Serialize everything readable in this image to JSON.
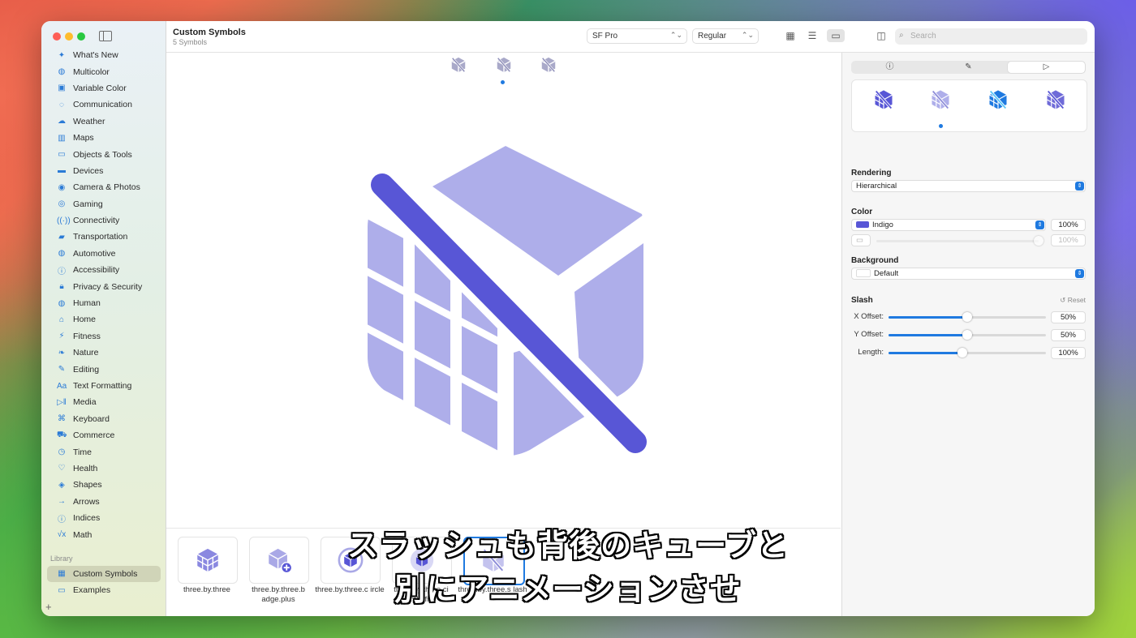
{
  "window": {
    "title": "Custom Symbols",
    "subtitle": "5 Symbols"
  },
  "sidebar": {
    "items": [
      {
        "label": "What's New",
        "icon": "sparkle-icon"
      },
      {
        "label": "Multicolor",
        "icon": "paintpalette-icon"
      },
      {
        "label": "Variable Color",
        "icon": "variable-color-icon"
      },
      {
        "label": "Communication",
        "icon": "message-icon"
      },
      {
        "label": "Weather",
        "icon": "cloud-sun-icon"
      },
      {
        "label": "Maps",
        "icon": "map-icon"
      },
      {
        "label": "Objects & Tools",
        "icon": "folder-icon"
      },
      {
        "label": "Devices",
        "icon": "display-icon"
      },
      {
        "label": "Camera & Photos",
        "icon": "camera-icon"
      },
      {
        "label": "Gaming",
        "icon": "gamecontroller-icon"
      },
      {
        "label": "Connectivity",
        "icon": "antenna-icon"
      },
      {
        "label": "Transportation",
        "icon": "car-icon"
      },
      {
        "label": "Automotive",
        "icon": "steeringwheel-icon"
      },
      {
        "label": "Accessibility",
        "icon": "accessibility-icon"
      },
      {
        "label": "Privacy & Security",
        "icon": "lock-icon"
      },
      {
        "label": "Human",
        "icon": "person-icon"
      },
      {
        "label": "Home",
        "icon": "house-icon"
      },
      {
        "label": "Fitness",
        "icon": "figure-run-icon"
      },
      {
        "label": "Nature",
        "icon": "leaf-icon"
      },
      {
        "label": "Editing",
        "icon": "pencil-icon"
      },
      {
        "label": "Text Formatting",
        "icon": "textformat-icon"
      },
      {
        "label": "Media",
        "icon": "playpause-icon"
      },
      {
        "label": "Keyboard",
        "icon": "command-icon"
      },
      {
        "label": "Commerce",
        "icon": "cart-icon"
      },
      {
        "label": "Time",
        "icon": "clock-icon"
      },
      {
        "label": "Health",
        "icon": "heart-icon"
      },
      {
        "label": "Shapes",
        "icon": "shapes-icon"
      },
      {
        "label": "Arrows",
        "icon": "arrow-right-icon"
      },
      {
        "label": "Indices",
        "icon": "index-circle-icon"
      },
      {
        "label": "Math",
        "icon": "sqrt-icon"
      }
    ],
    "library_header": "Library",
    "library_items": [
      {
        "label": "Custom Symbols",
        "icon": "custom-grid-icon",
        "selected": true
      },
      {
        "label": "Examples",
        "icon": "folder-icon",
        "selected": false
      }
    ]
  },
  "toolbar": {
    "font_popup": "SF Pro",
    "weight_popup": "Regular",
    "search_placeholder": "Search"
  },
  "symbols": [
    {
      "name": "three.by.three"
    },
    {
      "name": "three.by.three.badge.plus"
    },
    {
      "name": "three.by.three.circle"
    },
    {
      "name": "three.by.three.circle.fill"
    },
    {
      "name": "three.by.three.slash"
    }
  ],
  "symbol_labels": [
    "three.by.three",
    "three.by.three.b adge.plus",
    "three.by.three.c ircle",
    "three.by.three.ci rcle.fill",
    "three.by.three.s lash"
  ],
  "inspector": {
    "rendering_label": "Rendering",
    "rendering_value": "Hierarchical",
    "color_label": "Color",
    "color_value": "Indigo",
    "color_hex": "#5856d6",
    "color_opacity": "100%",
    "secondary_opacity": "100%",
    "background_label": "Background",
    "background_value": "Default",
    "slash_label": "Slash",
    "reset_label": "Reset",
    "sliders": [
      {
        "label": "X Offset:",
        "value": "50%",
        "fraction": 0.5
      },
      {
        "label": "Y Offset:",
        "value": "50%",
        "fraction": 0.5
      },
      {
        "label": "Length:",
        "value": "100%",
        "fraction": 0.47
      }
    ]
  },
  "subtitle": {
    "line1": "スラッシュも背後のキューブと",
    "line2": "別にアニメーションさせ"
  },
  "colors": {
    "accent": "#1f7ae0",
    "indigo": "#5856d6",
    "indigo_light": "#aeaeea"
  }
}
